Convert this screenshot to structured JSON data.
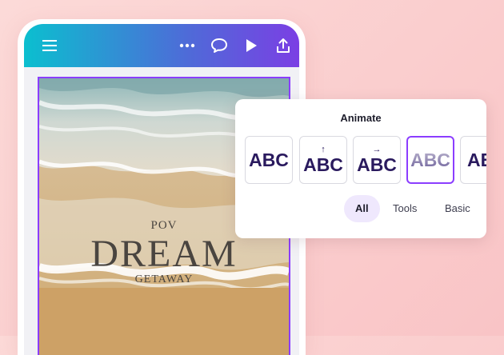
{
  "toolbar": {
    "icons": [
      "menu-icon",
      "more-icon",
      "comment-icon",
      "play-icon",
      "share-icon"
    ],
    "gradient": [
      "#0bbfcf",
      "#4f6ad8",
      "#7b3fe4"
    ]
  },
  "design": {
    "pov": "POV",
    "title": "DREAM",
    "subtitle": "GETAWAY",
    "selection_color": "#8b3dff"
  },
  "animate_panel": {
    "title": "Animate",
    "tiles": [
      "ABC",
      "ABC",
      "ABC",
      "ABC",
      "AB"
    ],
    "selected_index": 3,
    "tabs": [
      "All",
      "Tools",
      "Basic"
    ],
    "active_tab": "All"
  }
}
